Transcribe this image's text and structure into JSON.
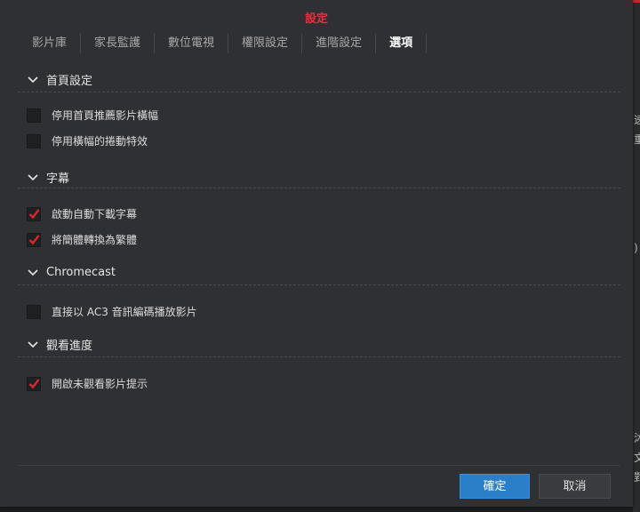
{
  "dialog": {
    "title": "設定"
  },
  "tabs": [
    {
      "label": "影片庫",
      "active": false
    },
    {
      "label": "家長監護",
      "active": false
    },
    {
      "label": "數位電視",
      "active": false
    },
    {
      "label": "權限設定",
      "active": false
    },
    {
      "label": "進階設定",
      "active": false
    },
    {
      "label": "選項",
      "active": true
    }
  ],
  "sections": {
    "home": {
      "title": "首頁設定",
      "options": [
        {
          "label": "停用首頁推薦影片橫幅",
          "checked": false
        },
        {
          "label": "停用橫幅的捲動特效",
          "checked": false
        }
      ]
    },
    "subtitle": {
      "title": "字幕",
      "options": [
        {
          "label": "啟動自動下載字幕",
          "checked": true
        },
        {
          "label": "將簡體轉換為繁體",
          "checked": true
        }
      ]
    },
    "chromecast": {
      "title": "Chromecast",
      "options": [
        {
          "label": "直接以 AC3 音訊編碼播放影片",
          "checked": false
        }
      ]
    },
    "progress": {
      "title": "觀看進度",
      "options": [
        {
          "label": "開啟未觀看影片提示",
          "checked": true
        }
      ]
    }
  },
  "buttons": {
    "ok": "確定",
    "cancel": "取消"
  },
  "colors": {
    "accent_red": "#e0343b",
    "check_red": "#d9262e",
    "primary_blue": "#2b7fc8"
  },
  "icons": {
    "section_toggle": "chevron-down-icon",
    "checkbox_checked": "checkmark-icon"
  }
}
